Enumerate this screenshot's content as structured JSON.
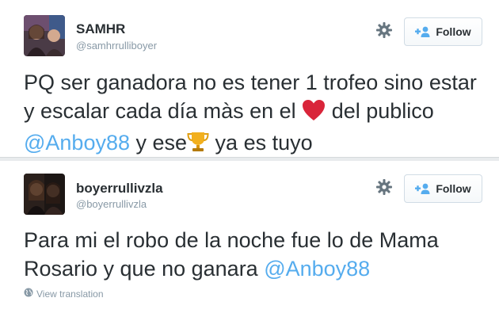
{
  "tweets": [
    {
      "display_name": "SAMHR",
      "handle": "@samhrrulliboyer",
      "follow_label": "Follow",
      "text_before": "PQ ser ganadora no es tener 1 trofeo sino estar y escalar cada día màs en el ",
      "emoji_1": "heart-emoji",
      "text_middle": " del publico ",
      "mention": "@Anboy88",
      "text_after_mention": " y ese",
      "emoji_2": "trophy-emoji",
      "text_end": " ya es tuyo"
    },
    {
      "display_name": "boyerrullivzla",
      "handle": "@boyerrullivzla",
      "follow_label": "Follow",
      "text_before": "Para mi el robo de la noche fue lo de Mama Rosario y que no ganara ",
      "mention": "@Anboy88",
      "view_translation": "View translation"
    }
  ],
  "icons": {
    "settings": "gear-icon",
    "follow": "add-person-icon",
    "translate": "globe-icon"
  },
  "colors": {
    "mention": "#55acee",
    "text": "#292f33",
    "muted": "#8899a6",
    "heart": "#e0245e",
    "trophy": "#f5a623"
  }
}
